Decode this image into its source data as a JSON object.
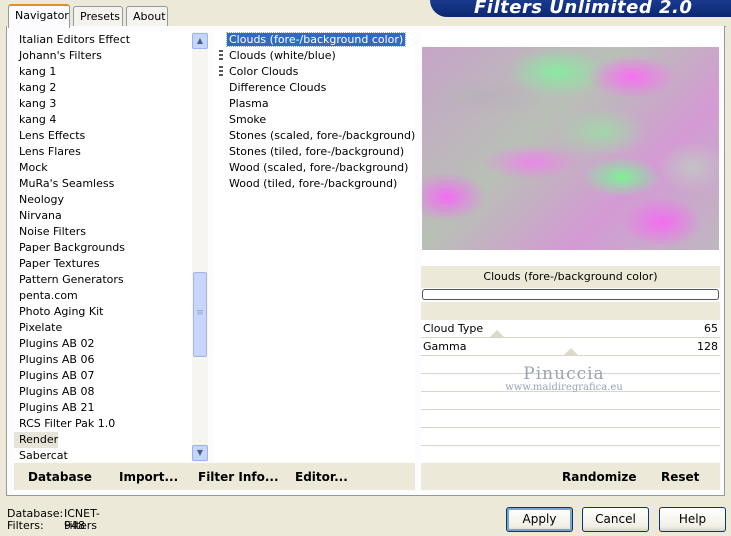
{
  "banner": "Filters Unlimited 2.0",
  "tabs": [
    {
      "label": "Navigator",
      "active": true
    },
    {
      "label": "Presets",
      "active": false
    },
    {
      "label": "About",
      "active": false
    }
  ],
  "categories": [
    "Italian Editors Effect",
    "Johann's Filters",
    "kang 1",
    "kang 2",
    "kang 3",
    "kang 4",
    "Lens Effects",
    "Lens Flares",
    "Mock",
    "MuRa's Seamless",
    "Neology",
    "Nirvana",
    "Noise Filters",
    "Paper Backgrounds",
    "Paper Textures",
    "Pattern Generators",
    "penta.com",
    "Photo Aging Kit",
    "Pixelate",
    "Plugins AB 02",
    "Plugins AB 06",
    "Plugins AB 07",
    "Plugins AB 08",
    "Plugins AB 21",
    "RCS Filter Pak 1.0",
    "Render",
    "Sabercat"
  ],
  "selected_category": "Render",
  "filters": [
    "Clouds (fore-/background color)",
    "Clouds (white/blue)",
    "Color Clouds",
    "Difference Clouds",
    "Plasma",
    "Smoke",
    "Stones (scaled, fore-/background)",
    "Stones (tiled, fore-/background)",
    "Wood (scaled, fore-/background)",
    "Wood (tiled, fore-/background)"
  ],
  "selected_filter": "Clouds (fore-/background color)",
  "preview_caption": "Clouds (fore-/background color)",
  "params": [
    {
      "name": "Cloud Type",
      "value": "65"
    },
    {
      "name": "Gamma",
      "value": "128"
    }
  ],
  "watermark": {
    "line1": "Pinuccia",
    "line2": "www.maidiregrafica.eu"
  },
  "toolbar": {
    "database": "Database",
    "import": "Import...",
    "filter_info": "Filter Info...",
    "editor": "Editor...",
    "randomize": "Randomize",
    "reset": "Reset"
  },
  "status": {
    "database_label": "Database:",
    "database_value": "ICNET-Filters",
    "filters_label": "Filters:",
    "filters_value": "948"
  },
  "buttons": {
    "apply": "Apply",
    "cancel": "Cancel",
    "help": "Help"
  },
  "icons": {
    "scroll_up": "chevron-up-icon",
    "scroll_down": "chevron-down-icon",
    "grip": "drag-grip-icon"
  }
}
